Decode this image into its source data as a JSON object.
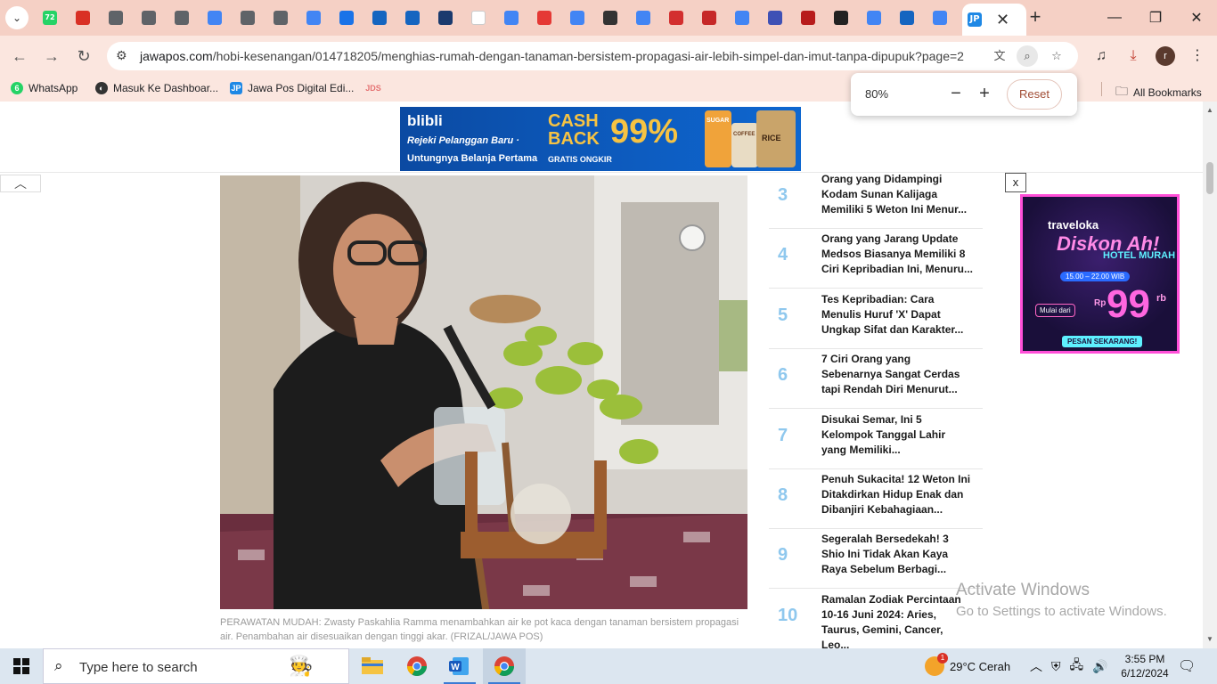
{
  "browser": {
    "tabs": [
      {
        "icon": "whatsapp-icon",
        "badge": "72",
        "color": "#25d366"
      },
      {
        "icon": "gmail-icon",
        "color": "#d93025"
      },
      {
        "icon": "globe-icon",
        "color": "#5f6368"
      },
      {
        "icon": "globe-icon",
        "color": "#5f6368"
      },
      {
        "icon": "globe-icon",
        "color": "#5f6368"
      },
      {
        "icon": "google-icon",
        "color": "#4285f4"
      },
      {
        "icon": "speaker-icon",
        "color": "#5f6368"
      },
      {
        "icon": "shield-icon",
        "color": "#5f6368"
      },
      {
        "icon": "google-icon",
        "color": "#4285f4"
      },
      {
        "icon": "chart-icon",
        "color": "#1a73e8"
      },
      {
        "icon": "house-icon",
        "color": "#1565c0"
      },
      {
        "icon": "house-icon",
        "color": "#1565c0"
      },
      {
        "icon": "map-icon",
        "color": "#1a3a6e"
      },
      {
        "icon": "blank-icon",
        "color": "#ffffff"
      },
      {
        "icon": "google-icon",
        "color": "#4285f4"
      },
      {
        "icon": "send-icon",
        "color": "#e53935"
      },
      {
        "icon": "google-icon",
        "color": "#4285f4"
      },
      {
        "icon": "wikipedia-icon",
        "color": "#333333"
      },
      {
        "icon": "google-icon",
        "color": "#4285f4"
      },
      {
        "icon": "red-square-icon",
        "color": "#d32f2f"
      },
      {
        "icon": "red-square-icon",
        "color": "#c62828"
      },
      {
        "icon": "google-icon",
        "color": "#4285f4"
      },
      {
        "icon": "wave-icon",
        "color": "#3f51b5"
      },
      {
        "icon": "flag-icon",
        "color": "#b71c1c"
      },
      {
        "icon": "glasses-icon",
        "color": "#222222"
      },
      {
        "icon": "google-icon",
        "color": "#4285f4"
      },
      {
        "icon": "arrow-icon",
        "color": "#1565c0"
      },
      {
        "icon": "google-icon",
        "color": "#4285f4"
      },
      {
        "icon": "jp-icon",
        "label": "JP",
        "color": "#1e88e5"
      }
    ],
    "active_tab_close": "✕",
    "url_host": "jawapos.com",
    "url_path": "/hobi-kesenangan/014718205/menghias-rumah-dengan-tanaman-bersistem-propagasi-air-lebih-simpel-dan-imut-tanpa-dipupuk?page=2",
    "profile_initial": "r",
    "bookmarks": [
      {
        "icon": "whatsapp-icon",
        "label": "WhatsApp",
        "color": "#25d366"
      },
      {
        "icon": "globe-dark-icon",
        "label": "Masuk Ke Dashboar...",
        "color": "#333333"
      },
      {
        "icon": "jp-icon",
        "label": "Jawa Pos Digital Edi...",
        "color": "#1e88e5"
      },
      {
        "icon": "jds-icon",
        "label": "",
        "color": "#e57373"
      }
    ],
    "all_bookmarks": "All Bookmarks",
    "zoom": {
      "value": "80%",
      "minus": "−",
      "plus": "+",
      "reset": "Reset"
    }
  },
  "page": {
    "banner": {
      "brand": "blibli",
      "tag1": "Rejeki Pelanggan Baru ·",
      "tag2": "Untungnya Belanja Pertama",
      "cashback": "CASH BACK",
      "percent": "99%",
      "ongkir": "GRATIS ONGKIR",
      "product_labels": [
        "SUGAR",
        "COFFEE",
        "RICE"
      ]
    },
    "caption": "PERAWATAN MUDAH: Zwasty Paskahlia Ramma menambahkan air ke pot kaca dengan tanaman bersistem propagasi air. Penambahan air disesuaikan dengan tinggi akar. (FRIZAL/JAWA POS)",
    "popular": [
      {
        "num": "3",
        "title": "Orang yang Didampingi Kodam Sunan Kalijaga Memiliki 5 Weton Ini Menur..."
      },
      {
        "num": "4",
        "title": "Orang yang Jarang Update Medsos Biasanya Memiliki 8 Ciri Kepribadian Ini, Menuru..."
      },
      {
        "num": "5",
        "title": "Tes Kepribadian: Cara Menulis Huruf 'X' Dapat Ungkap Sifat dan Karakter..."
      },
      {
        "num": "6",
        "title": "7 Ciri Orang yang Sebenarnya Sangat Cerdas tapi Rendah Diri Menurut..."
      },
      {
        "num": "7",
        "title": "Disukai Semar, Ini 5 Kelompok Tanggal Lahir yang Memiliki..."
      },
      {
        "num": "8",
        "title": "Penuh Sukacita! 12 Weton Ini Ditakdirkan Hidup Enak dan Dibanjiri Kebahagiaan..."
      },
      {
        "num": "9",
        "title": "Segeralah Bersedekah! 3 Shio Ini Tidak Akan Kaya Raya Sebelum Berbagi..."
      },
      {
        "num": "10",
        "title": "Ramalan Zodiak Percintaan 10-16 Juni 2024: Aries, Taurus, Gemini, Cancer, Leo..."
      }
    ],
    "ad": {
      "close": "x",
      "brand": "traveloka",
      "headline": "Diskon Ah!",
      "sub": "HOTEL MURAH",
      "time": "15.00 – 22.00 WIB",
      "mulai": "Mulai dari",
      "rp": "Rp",
      "price": "99",
      "rb": "rb",
      "cta": "PESAN SEKARANG!"
    },
    "watermark": {
      "line1": "Activate Windows",
      "line2": "Go to Settings to activate Windows."
    }
  },
  "taskbar": {
    "search_placeholder": "Type here to search",
    "weather": "29°C  Cerah",
    "weather_badge": "1",
    "time": "3:55 PM",
    "date": "6/12/2024"
  }
}
